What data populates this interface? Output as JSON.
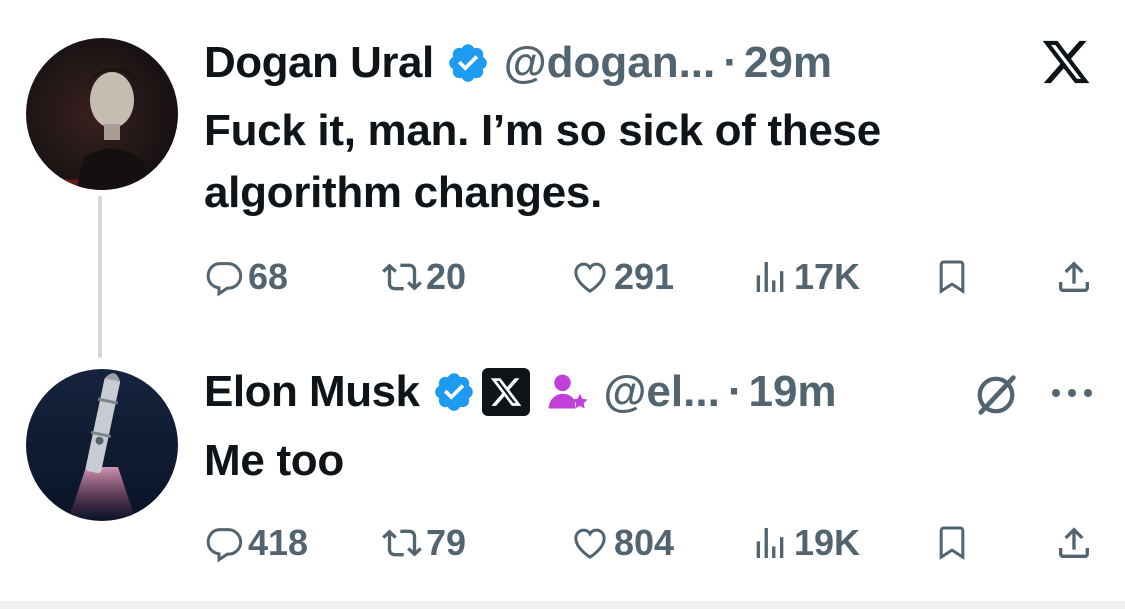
{
  "tweets": [
    {
      "author": "Dogan Ural",
      "handle": "@dogan...",
      "separator": "·",
      "time": "29m",
      "text_line1": "Fuck it, man. I’m so sick of these",
      "text_line2": "algorithm changes.",
      "verified": true,
      "replies": "68",
      "retweets": "20",
      "likes": "291",
      "views": "17K"
    },
    {
      "author": "Elon Musk",
      "handle": "@el...",
      "separator": "·",
      "time": "19m",
      "text": "Me too",
      "verified": true,
      "affiliation_badge": "x-logo-badge",
      "replies": "418",
      "retweets": "79",
      "likes": "804",
      "views": "19K"
    }
  ],
  "icons": {
    "corner": "x-logo-icon",
    "grok": "grok-icon",
    "more": "more-icon"
  },
  "colors": {
    "verified_blue": "#1d9bf0",
    "muted_text": "#536471",
    "affiliation_purple": "#c140d9"
  }
}
